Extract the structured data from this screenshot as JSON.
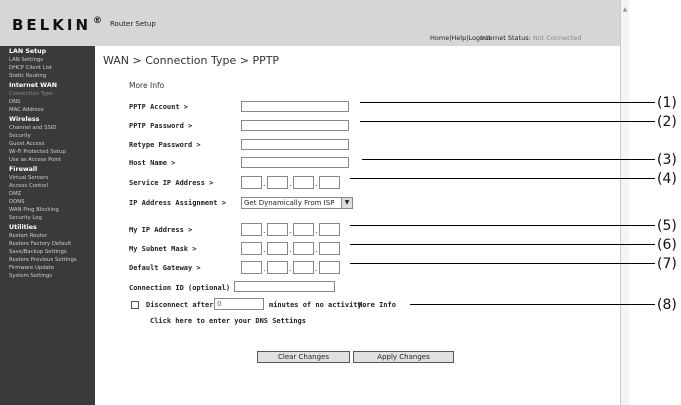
{
  "header": {
    "brand": "BELKIN",
    "brand_mark": "®",
    "app_title": "Router Setup",
    "links": [
      "Home",
      "Help",
      "Logout"
    ],
    "internet_status_label": "Internet Status:",
    "internet_status_value": "Not Connected"
  },
  "sidebar": {
    "sections": [
      {
        "title": "LAN Setup",
        "items": [
          "LAN Settings",
          "DHCP Client List",
          "Static Routing"
        ]
      },
      {
        "title": "Internet WAN",
        "items": [
          "Connection Type",
          "DNS",
          "MAC Address"
        ]
      },
      {
        "title": "Wireless",
        "items": [
          "Channel and SSID",
          "Security",
          "Guest Access",
          "Wi-Fi Protected Setup",
          "Use as Access Point"
        ]
      },
      {
        "title": "Firewall",
        "items": [
          "Virtual Servers",
          "Access Control",
          "DMZ",
          "DDNS",
          "WAN Ping Blocking",
          "Security Log"
        ]
      },
      {
        "title": "Utilities",
        "items": [
          "Restart Router",
          "Restore Factory Default",
          "Save/Backup Settings",
          "Restore Previous Settings",
          "Firmware Update",
          "System Settings"
        ]
      }
    ]
  },
  "main": {
    "breadcrumb": "WAN > Connection Type > PPTP",
    "more_info": "More Info",
    "fields": {
      "pptp_account": "PPTP Account >",
      "pptp_password": "PPTP Password >",
      "retype_password": "Retype Password >",
      "host_name": "Host Name >",
      "service_ip": "Service IP Address >",
      "ip_assignment": "IP Address Assignment >",
      "my_ip": "My IP Address >",
      "subnet_mask": "My Subnet Mask >",
      "gateway": "Default Gateway >",
      "connection_id": "Connection ID (optional) >"
    },
    "ip_assignment_value": "Get Dynamically From ISP",
    "disconnect": {
      "label": "Disconnect after",
      "value": "0",
      "suffix": "minutes of no activity.",
      "more_info": "More Info"
    },
    "dns_link": "Click here to enter your DNS Settings",
    "buttons": {
      "clear": "Clear Changes",
      "apply": "Apply Changes"
    }
  },
  "callouts": [
    "(1)",
    "(2)",
    "(3)",
    "(4)",
    "(5)",
    "(6)",
    "(7)",
    "(8)"
  ]
}
